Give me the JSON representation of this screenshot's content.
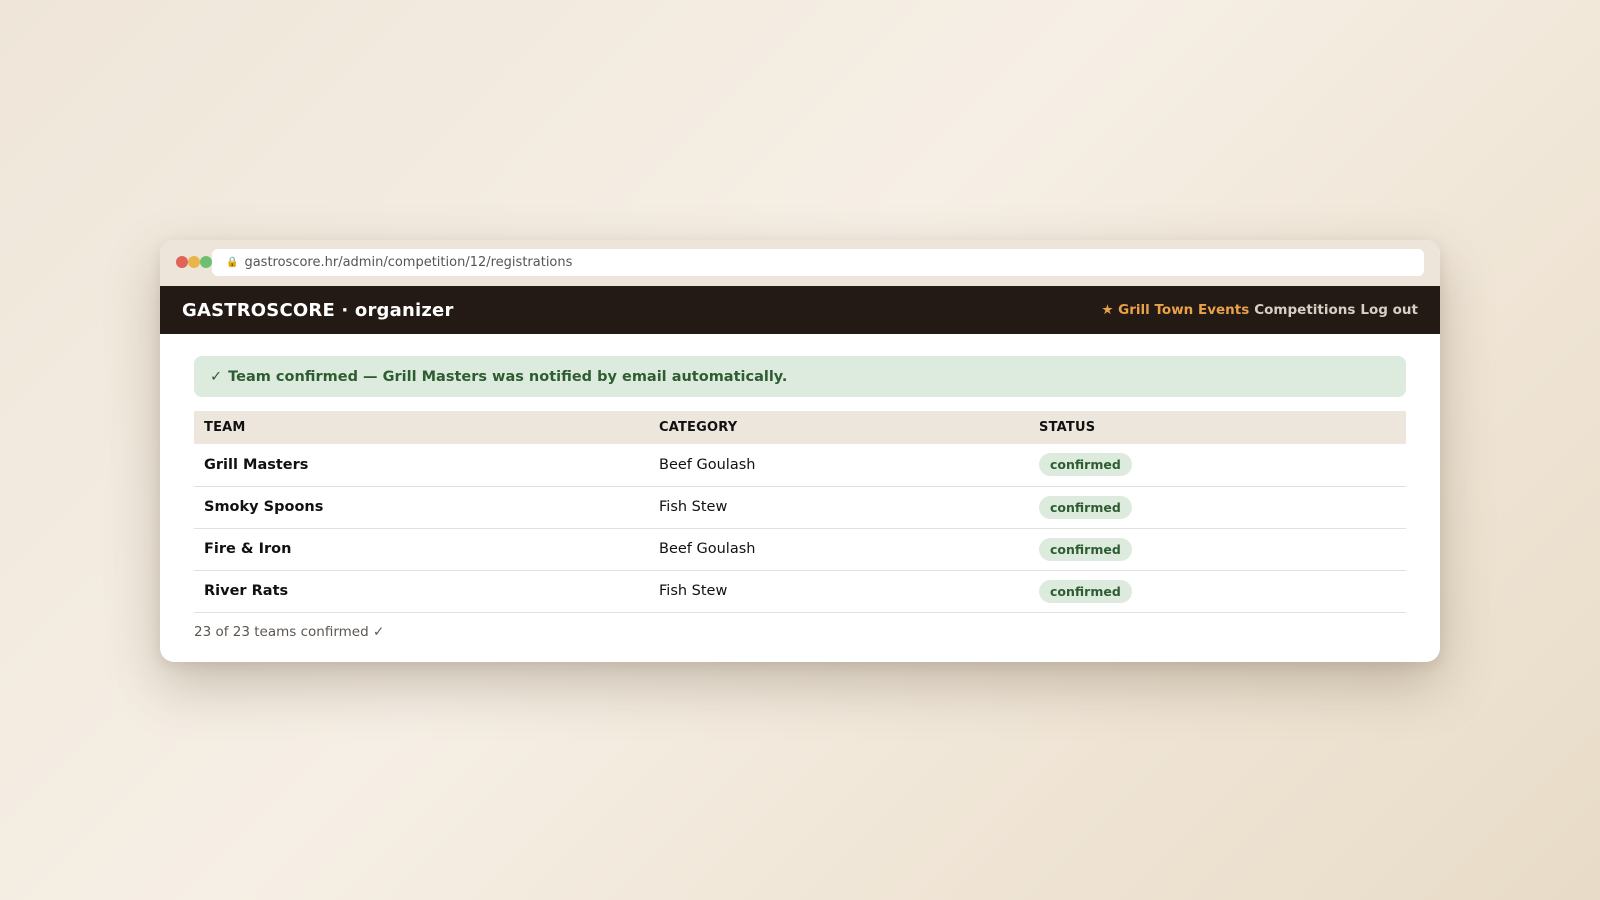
{
  "browser": {
    "url": "gastroscore.hr/admin/competition/12/registrations",
    "lock_icon": "lock-icon"
  },
  "navbar": {
    "brand": "GASTROSCORE · organizer",
    "event_link": "★ Grill Town Events",
    "links": [
      "Competitions",
      "Log out"
    ]
  },
  "alert": {
    "icon": "✓",
    "message": "Team confirmed — Grill Masters was notified by email automatically."
  },
  "table": {
    "headers": [
      "TEAM",
      "CATEGORY",
      "STATUS"
    ],
    "rows": [
      {
        "team": "Grill Masters",
        "category": "Beef Goulash",
        "status": "confirmed"
      },
      {
        "team": "Smoky Spoons",
        "category": "Fish Stew",
        "status": "confirmed"
      },
      {
        "team": "Fire & Iron",
        "category": "Beef Goulash",
        "status": "confirmed"
      },
      {
        "team": "River Rats",
        "category": "Fish Stew",
        "status": "confirmed"
      }
    ]
  },
  "footer": {
    "count_text": "23 of 23 teams confirmed ✓"
  },
  "colors": {
    "navbar_bg": "#231915",
    "accent": "#e8a24a",
    "success_bg": "#dcebdd",
    "success_text": "#2f5d32"
  }
}
